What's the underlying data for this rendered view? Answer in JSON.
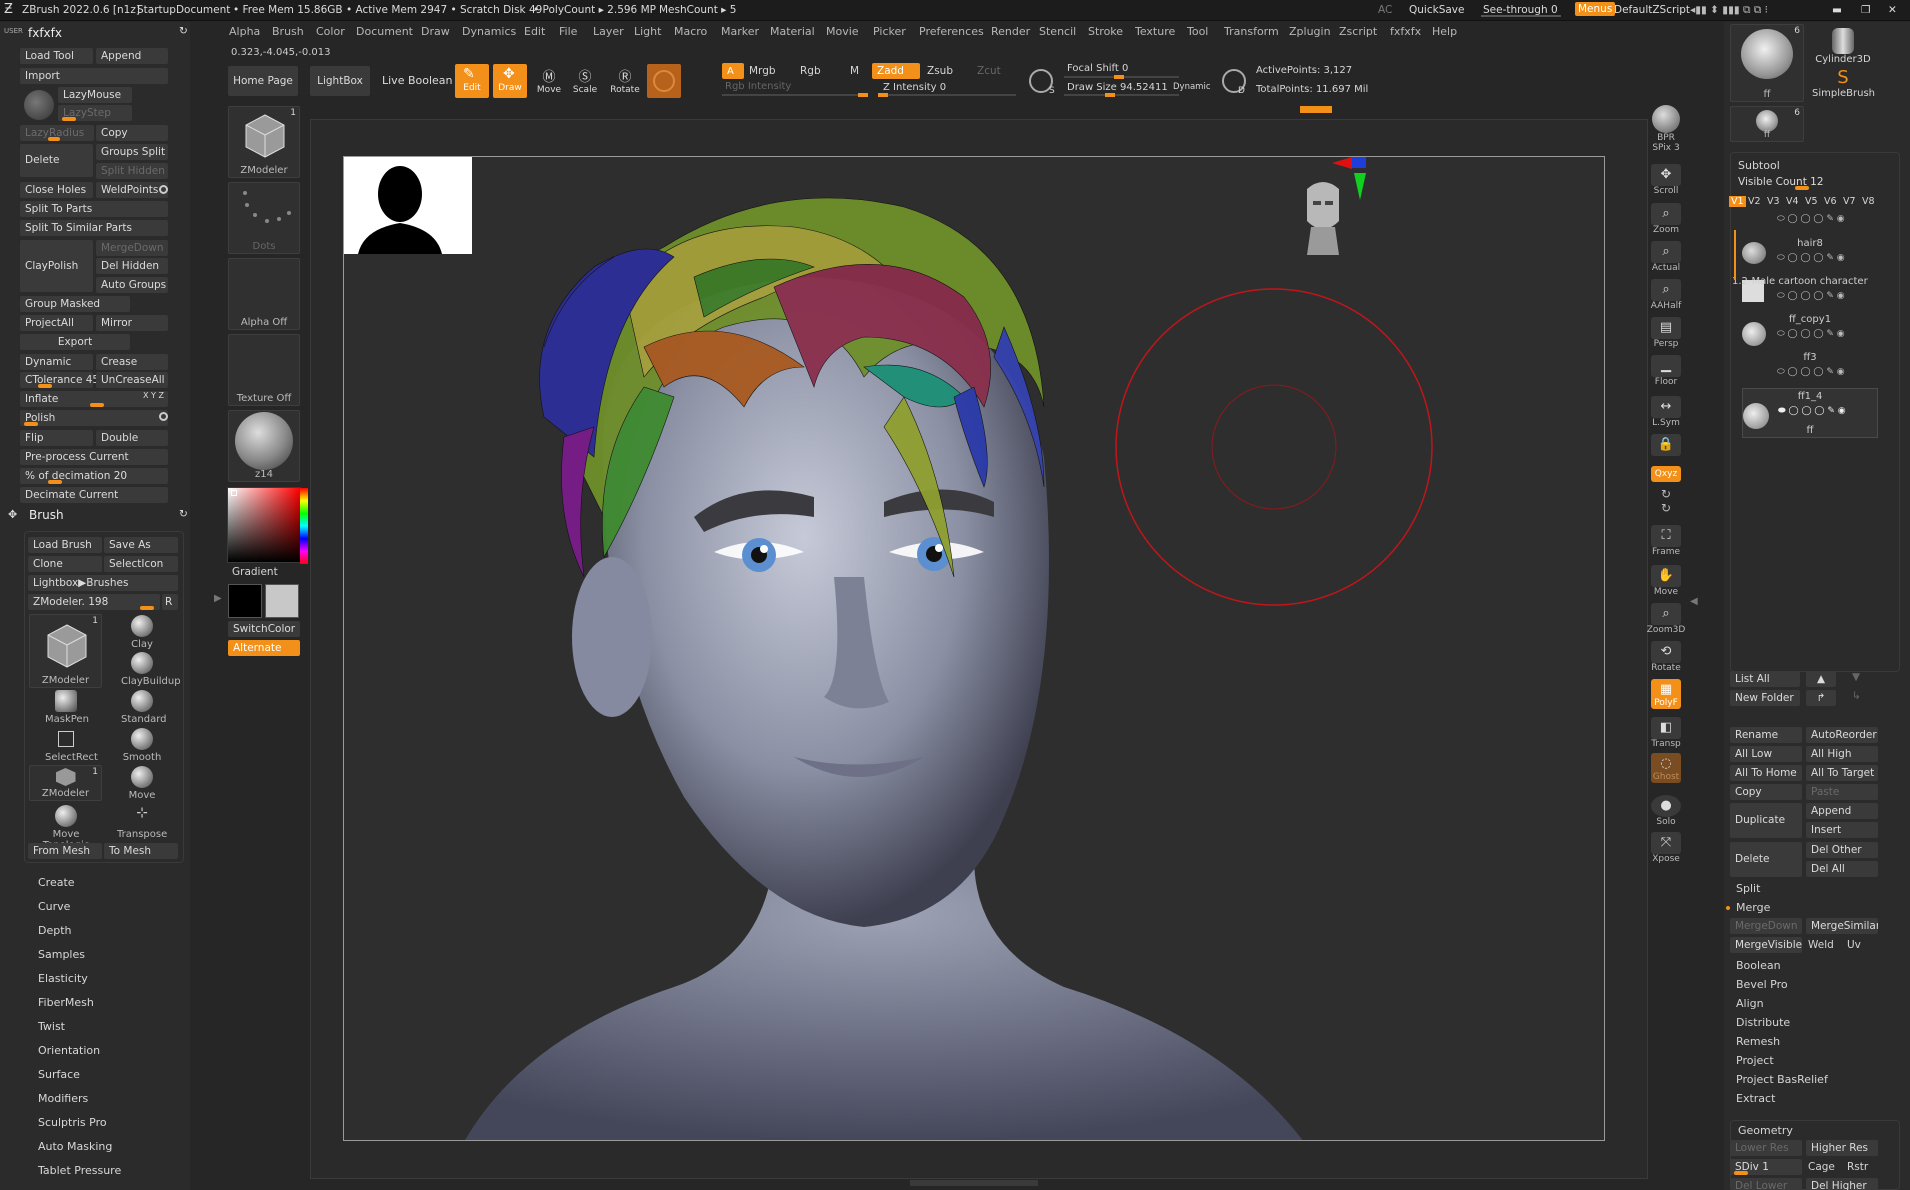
{
  "topbar": {
    "app": "ZBrush 2022.0.6 [n1z]",
    "doc": "StartupDocument",
    "mem": "• Free Mem 15.86GB • Active Mem 2947 • Scratch Disk 49",
    "poly": "• PolyCount ▸ 2.596 MP",
    "mesh": "MeshCount ▸ 5",
    "ac": "AC",
    "quicksave": "QuickSave",
    "seethrough": "See-through  0",
    "menus": "Menus",
    "script": "DefaultZScript"
  },
  "menu": [
    "Alpha",
    "Brush",
    "Color",
    "Document",
    "Draw",
    "Dynamics",
    "Edit",
    "File",
    "Layer",
    "Light",
    "Macro",
    "Marker",
    "Material",
    "Movie",
    "Picker",
    "Preferences",
    "Render",
    "Stencil",
    "Stroke",
    "Texture",
    "Tool",
    "Transform",
    "Zplugin",
    "Zscript",
    "fxfxfx",
    "Help"
  ],
  "coords": "0.323,-4.045,-0.013",
  "toolbar": {
    "home": "Home Page",
    "lightbox": "LightBox",
    "liveboolean": "Live Boolean",
    "edit": "Edit",
    "draw": "Draw",
    "move": "Move",
    "scale": "Scale",
    "rotate": "Rotate",
    "a": "A",
    "mrgb": "Mrgb",
    "rgb": "Rgb",
    "m": "M",
    "zadd": "Zadd",
    "zsub": "Zsub",
    "zcut": "Zcut",
    "rgbint": "Rgb Intensity",
    "zint": "Z Intensity 0",
    "focal": "Focal Shift 0",
    "drawsize": "Draw Size",
    "drawsizeval": "94.52411",
    "dynamic": "Dynamic",
    "active": "ActivePoints: 3,127",
    "total": "TotalPoints: 11.697 Mil",
    "s": "S",
    "d": "D"
  },
  "left": {
    "user": "USER",
    "title": "fxfxfx",
    "loadtool": "Load Tool",
    "append": "Append",
    "import": "Import",
    "lazymouse": "LazyMouse",
    "lazystep": "LazyStep",
    "lazyradius": "LazyRadius",
    "copy": "Copy",
    "delete": "Delete",
    "groupsplit": "Groups Split",
    "splithidden": "Split Hidden",
    "closeholes": "Close Holes",
    "weldpoints": "WeldPoints",
    "splitparts": "Split To Parts",
    "splitsimilar": "Split To Similar Parts",
    "claypolish": "ClayPolish",
    "mergedown": "MergeDown",
    "delhidden": "Del Hidden",
    "autogroups": "Auto Groups",
    "groupmasked": "Group Masked",
    "projectall": "ProjectAll",
    "mirror": "Mirror",
    "export": "Export",
    "dynamic": "Dynamic",
    "crease": "Crease",
    "ctol": "CTolerance 45",
    "uncrease": "UnCreaseAll",
    "inflate": "Inflate",
    "xyz": "X Y Z",
    "polish": "Polish",
    "flip": "Flip",
    "double": "Double",
    "preprocess": "Pre-process Current",
    "decimation": "% of decimation 20",
    "decimate": "Decimate Current"
  },
  "brush": {
    "title": "Brush",
    "loadbrush": "Load Brush",
    "saveas": "Save As",
    "clone": "Clone",
    "selecticon": "SelectIcon",
    "lightbox": "Lightbox▶Brushes",
    "zmodeler": "ZModeler. 198",
    "r": "R",
    "items": [
      "ZModeler",
      "Clay",
      "ClayBuildup",
      "MaskPen",
      "Standard",
      "SelectRect",
      "Smooth",
      "ZModeler",
      "Move",
      "Move Topologic",
      "Transpose"
    ],
    "frommesh": "From Mesh",
    "tomesh": "To Mesh",
    "one": "1"
  },
  "accordion": [
    "Create",
    "Curve",
    "Depth",
    "Samples",
    "Elasticity",
    "FiberMesh",
    "Twist",
    "Orientation",
    "Surface",
    "Modifiers",
    "Sculptris Pro",
    "Auto Masking",
    "Tablet Pressure"
  ],
  "mid": {
    "zmodeler": "ZModeler",
    "dots": "Dots",
    "alphaoff": "Alpha Off",
    "textureoff": "Texture Off",
    "mat": "z14",
    "gradient": "Gradient",
    "switchcolor": "SwitchColor",
    "alternate": "Alternate",
    "one": "1"
  },
  "righttools": [
    "BPR",
    "SPix 3",
    "Scroll",
    "Zoom",
    "Actual",
    "AAHalf",
    "Persp",
    "Floor",
    "L.Sym",
    "Qxyz",
    "Frame",
    "Move",
    "Zoom3D",
    "Rotate",
    "PolyF",
    "Transp",
    "Ghost",
    "Solo",
    "Xpose"
  ],
  "rightpanel": {
    "thumb1": "ff",
    "thumb2": "ff",
    "cyl": "Cylinder3D",
    "simple": "SimpleBrush",
    "six": "6",
    "subtool": "Subtool",
    "visible": "Visible Count 12",
    "vs": [
      "V1",
      "V2",
      "V3",
      "V4",
      "V5",
      "V6",
      "V7",
      "V8"
    ],
    "items": [
      "hair8",
      "1.2-Male cartoon character",
      "ff_copy1",
      "ff3",
      "ff1_4",
      "ff"
    ],
    "listall": "List All",
    "newfolder": "New Folder",
    "rename": "Rename",
    "autoreorder": "AutoReorder",
    "alllow": "All Low",
    "allhigh": "All High",
    "allhome": "All To Home",
    "alltarget": "All To Target",
    "copy": "Copy",
    "paste": "Paste",
    "duplicate": "Duplicate",
    "append": "Append",
    "insert": "Insert",
    "delete": "Delete",
    "delother": "Del Other",
    "delall": "Del All",
    "split": "Split",
    "merge": "Merge",
    "mergedown": "MergeDown",
    "mergesimilar": "MergeSimilar",
    "mergevisible": "MergeVisible",
    "weld": "Weld",
    "uv": "Uv",
    "boolean": "Boolean",
    "bevel": "Bevel Pro",
    "align": "Align",
    "distribute": "Distribute",
    "remesh": "Remesh",
    "project": "Project",
    "projectbas": "Project BasRelief",
    "extract": "Extract",
    "geometry": "Geometry",
    "lowerres": "Lower Res",
    "higherres": "Higher Res",
    "sdiv": "SDiv 1",
    "cage": "Cage",
    "rstr": "Rstr",
    "dellower": "Del Lower",
    "delhigher": "Del Higher"
  },
  "colors": {
    "accent": "#f39019",
    "bg": "#262626"
  }
}
